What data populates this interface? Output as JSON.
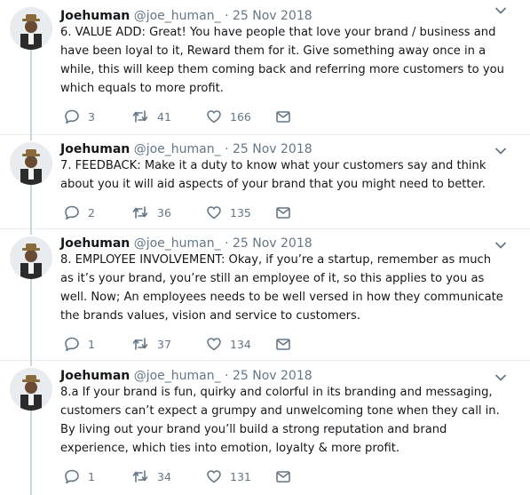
{
  "tweets": [
    {
      "name": "Joehuman",
      "handle": "@joe_human_",
      "separator": "·",
      "date": "25 Nov 2018",
      "text": "6. VALUE ADD: Great! You have people that love your brand / business and have been loyal to it, Reward them for it. Give something away once in a while, this will keep them coming back and referring more customers to you which equals to more profit.",
      "replies": "3",
      "retweets": "41",
      "likes": "166"
    },
    {
      "name": "Joehuman",
      "handle": "@joe_human_",
      "separator": "·",
      "date": "25 Nov 2018",
      "text": "7. FEEDBACK: Make it a duty to know what your customers say and think about you it will aid aspects of your brand that you might need to better.",
      "replies": "2",
      "retweets": "36",
      "likes": "135"
    },
    {
      "name": "Joehuman",
      "handle": "@joe_human_",
      "separator": "·",
      "date": "25 Nov 2018",
      "text": "8. EMPLOYEE INVOLVEMENT: Okay, if you’re a startup, remember as much as it’s your brand, you’re still an employee of it, so this applies to you as well. Now; An employees needs to be well versed in how they communicate the brands values, vision and service to customers.",
      "replies": "1",
      "retweets": "37",
      "likes": "134"
    },
    {
      "name": "Joehuman",
      "handle": "@joe_human_",
      "separator": "·",
      "date": "25 Nov 2018",
      "text": "8.a If your brand is fun, quirky and colorful in its branding and messaging, customers can’t expect a grumpy and unwelcoming tone when they call in. By living out your brand you’ll build a strong reputation and brand experience, which ties into emotion, loyalty & more profit.",
      "replies": "1",
      "retweets": "34",
      "likes": "131"
    }
  ],
  "icons": {
    "reply": "reply-icon",
    "retweet": "retweet-icon",
    "like": "heart-icon",
    "dm": "envelope-icon",
    "more": "chevron-down-icon"
  },
  "colors": {
    "text": "#14171a",
    "secondary": "#657786",
    "icon": "#657786",
    "thread": "#ccd6dd",
    "divider": "#e6ecf0"
  }
}
